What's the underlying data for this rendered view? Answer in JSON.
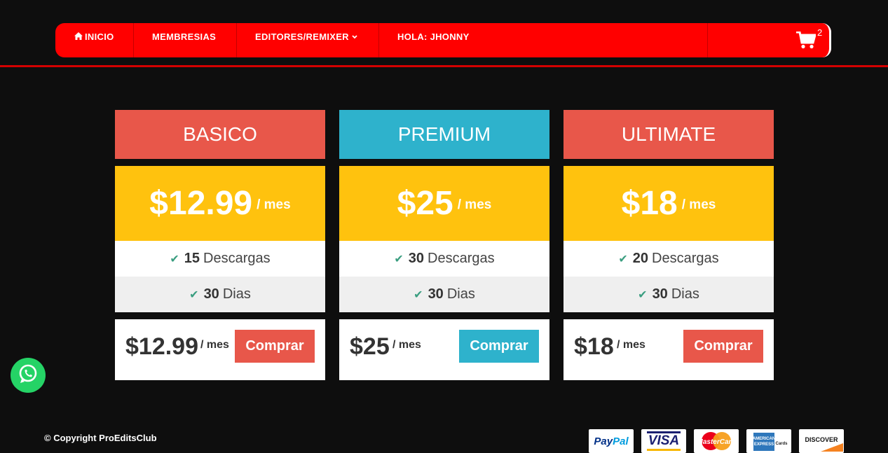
{
  "nav": {
    "inicio": "INICIO",
    "membresias": "MEMBRESIAS",
    "editores": "EDITORES/REMIXER",
    "hola": "HOLA: JHONNY",
    "cart_count": "2"
  },
  "plans": [
    {
      "name": "BASICO",
      "header_color": "#e8574a",
      "price": "$12.99",
      "per": "/ mes",
      "features": [
        {
          "num": "15",
          "text": "Descargas"
        },
        {
          "num": "30",
          "text": "Dias"
        }
      ],
      "foot_price": "$12.99",
      "foot_per": "/ mes",
      "button": "Comprar",
      "button_color": "#e8574a"
    },
    {
      "name": "PREMIUM",
      "header_color": "#2eb2cc",
      "price": "$25",
      "per": "/ mes",
      "features": [
        {
          "num": "30",
          "text": "Descargas"
        },
        {
          "num": "30",
          "text": "Dias"
        }
      ],
      "foot_price": "$25",
      "foot_per": "/ mes",
      "button": "Comprar",
      "button_color": "#2eb2cc"
    },
    {
      "name": "ULTIMATE",
      "header_color": "#e8574a",
      "price": "$18",
      "per": "/ mes",
      "features": [
        {
          "num": "20",
          "text": "Descargas"
        },
        {
          "num": "30",
          "text": "Dias"
        }
      ],
      "foot_price": "$18",
      "foot_per": "/ mes",
      "button": "Comprar",
      "button_color": "#e8574a"
    }
  ],
  "footer": {
    "copyright": "© Copyright ProEditsClub",
    "payments": [
      "PayPal",
      "VISA",
      "MasterCard",
      "American Express",
      "DISCOVER"
    ]
  },
  "colors": {
    "nav_red": "#ff0000",
    "price_yellow": "#ffc20e",
    "whatsapp": "#25d366"
  }
}
